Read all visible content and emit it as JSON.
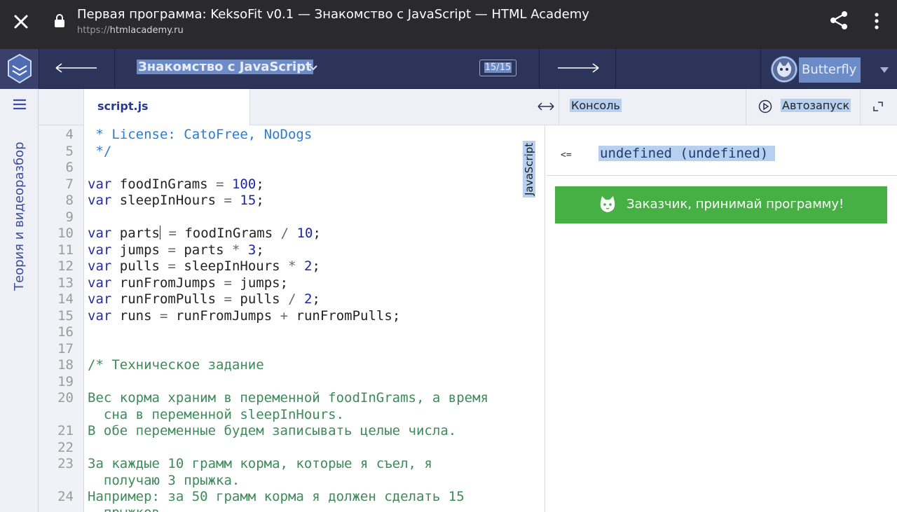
{
  "browser": {
    "title": "Первая программа: KeksoFit v0.1 — Знакомство с JavaScript — HTML Academy",
    "url_scheme": "https://",
    "url_host": "htmlacademy.ru"
  },
  "nav": {
    "course_title": "Знакомство с JavaScript",
    "counter": "15/15",
    "username": "Butterfly"
  },
  "rail": {
    "label": "Теория и видеоразбор"
  },
  "editor": {
    "file_tab": "script.js",
    "language": "JavaScript",
    "line_numbers": [
      "4",
      "5",
      "6",
      "7",
      "8",
      "9",
      "10",
      "11",
      "12",
      "13",
      "14",
      "15",
      "16",
      "17",
      "18",
      "19",
      "20",
      "21",
      "22",
      "23",
      "24"
    ],
    "tokens": {
      "var": "var",
      "line4": " * License: CatoFree, NoDogs",
      "line5": " */",
      "foodInGrams": "foodInGrams",
      "sleepInHours": "sleepInHours",
      "parts": "parts",
      "jumps": "jumps",
      "pulls": "pulls",
      "runFromJumps": "runFromJumps",
      "runFromPulls": "runFromPulls",
      "runs": "runs",
      "eq": "=",
      "div": "/",
      "mul": "*",
      "plus": "+",
      "semi": ";",
      "n100": "100",
      "n15": "15",
      "n10": "10",
      "n3": "3",
      "n2": "2",
      "line18": "/* Техническое задание",
      "line20a": "Вес корма храним в переменной foodInGrams, а время",
      "line20b": "  сна в переменной sleepInHours.",
      "line21": "В обе переменные будем записывать целые числа.",
      "line23a": "За каждые 10 грамм корма, которые я съел, я",
      "line23b": "  получаю 3 прыжка.",
      "line24a": "Например: за 50 грамм корма я должен сделать 15",
      "line24b": "  прыжков."
    }
  },
  "panel": {
    "console_tab": "Консоль",
    "autorun": "Автозапуск",
    "console_arrow": "<=",
    "console_value": "undefined (undefined)",
    "accept_button": "Заказчик, принимай программу!"
  },
  "icons": [
    "close-icon",
    "lock-icon",
    "share-icon",
    "more-vert-icon",
    "academy-logo-icon",
    "back-arrow-icon",
    "chevron-down-icon",
    "forward-arrow-icon",
    "avatar-icon",
    "caret-down-icon",
    "hamburger-icon",
    "resize-icon",
    "play-icon",
    "expand-icon",
    "cat-icon"
  ],
  "colors": {
    "browser_bar": "#2a2a2c",
    "nav_bar": "#2d3459",
    "accent_green": "#47b045",
    "selection": "#b7d0ef",
    "rail_text": "#3d4f9e"
  }
}
